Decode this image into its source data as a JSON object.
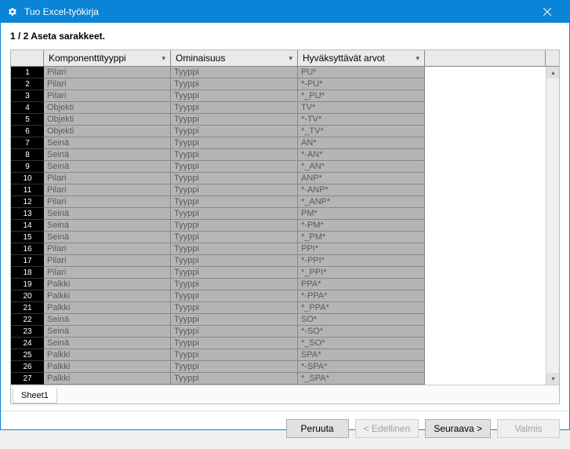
{
  "window": {
    "title": "Tuo Excel-työkirja"
  },
  "step_label": "1 / 2 Aseta sarakkeet.",
  "columns": {
    "a": "Komponenttityyppi",
    "b": "Ominaisuus",
    "c": "Hyväksyttävät arvot"
  },
  "rows": [
    {
      "n": "1",
      "a": "Pilari",
      "b": "Tyyppi",
      "c": "PU*"
    },
    {
      "n": "2",
      "a": "Pilari",
      "b": "Tyyppi",
      "c": "*-PU*"
    },
    {
      "n": "3",
      "a": "Pilari",
      "b": "Tyyppi",
      "c": "*_PU*"
    },
    {
      "n": "4",
      "a": "Objekti",
      "b": "Tyyppi",
      "c": "TV*"
    },
    {
      "n": "5",
      "a": "Objekti",
      "b": "Tyyppi",
      "c": "*-TV*"
    },
    {
      "n": "6",
      "a": "Objekti",
      "b": "Tyyppi",
      "c": "*_TV*"
    },
    {
      "n": "7",
      "a": "Seinä",
      "b": "Tyyppi",
      "c": "AN*"
    },
    {
      "n": "8",
      "a": "Seinä",
      "b": "Tyyppi",
      "c": "*-AN*"
    },
    {
      "n": "9",
      "a": "Seinä",
      "b": "Tyyppi",
      "c": "*_AN*"
    },
    {
      "n": "10",
      "a": "Pilari",
      "b": "Tyyppi",
      "c": "ANP*"
    },
    {
      "n": "11",
      "a": "Pilari",
      "b": "Tyyppi",
      "c": "*-ANP*"
    },
    {
      "n": "12",
      "a": "Pilari",
      "b": "Tyyppi",
      "c": "*_ANP*"
    },
    {
      "n": "13",
      "a": "Seinä",
      "b": "Tyyppi",
      "c": "PM*"
    },
    {
      "n": "14",
      "a": "Seinä",
      "b": "Tyyppi",
      "c": "*-PM*"
    },
    {
      "n": "15",
      "a": "Seinä",
      "b": "Tyyppi",
      "c": "*_PM*"
    },
    {
      "n": "16",
      "a": "Pilari",
      "b": "Tyyppi",
      "c": "PPI*"
    },
    {
      "n": "17",
      "a": "Pilari",
      "b": "Tyyppi",
      "c": "*-PPI*"
    },
    {
      "n": "18",
      "a": "Pilari",
      "b": "Tyyppi",
      "c": "*_PPI*"
    },
    {
      "n": "19",
      "a": "Palkki",
      "b": "Tyyppi",
      "c": "PPA*"
    },
    {
      "n": "20",
      "a": "Palkki",
      "b": "Tyyppi",
      "c": "*-PPA*"
    },
    {
      "n": "21",
      "a": "Palkki",
      "b": "Tyyppi",
      "c": "*_PPA*"
    },
    {
      "n": "22",
      "a": "Seinä",
      "b": "Tyyppi",
      "c": "SO*"
    },
    {
      "n": "23",
      "a": "Seinä",
      "b": "Tyyppi",
      "c": "*-SO*"
    },
    {
      "n": "24",
      "a": "Seinä",
      "b": "Tyyppi",
      "c": "*_SO*"
    },
    {
      "n": "25",
      "a": "Palkki",
      "b": "Tyyppi",
      "c": "SPA*"
    },
    {
      "n": "26",
      "a": "Palkki",
      "b": "Tyyppi",
      "c": "*-SPA*"
    },
    {
      "n": "27",
      "a": "Palkki",
      "b": "Tyyppi",
      "c": "*_SPA*"
    }
  ],
  "sheet_tab": "Sheet1",
  "buttons": {
    "cancel": "Peruuta",
    "prev": "< Edellinen",
    "next": "Seuraava >",
    "finish": "Valmis"
  }
}
